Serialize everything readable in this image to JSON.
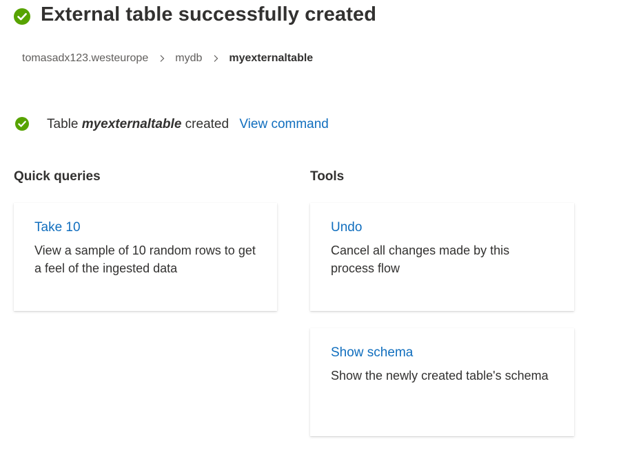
{
  "header": {
    "title": "External table successfully created",
    "status_color": "#57a300"
  },
  "breadcrumb": {
    "items": [
      "tomasadx123.westeurope",
      "mydb",
      "myexternaltable"
    ]
  },
  "status": {
    "prefix": "Table",
    "table_name": "myexternaltable",
    "suffix": "created",
    "view_command": "View command"
  },
  "quick_queries": {
    "heading": "Quick queries",
    "cards": [
      {
        "title": "Take 10",
        "description": "View a sample of 10 random rows to get a feel of the ingested data"
      }
    ]
  },
  "tools": {
    "heading": "Tools",
    "cards": [
      {
        "title": "Undo",
        "description": "Cancel all changes made by this process flow"
      },
      {
        "title": "Show schema",
        "description": "Show the newly created table's schema"
      }
    ]
  },
  "colors": {
    "link": "#106ebe",
    "text": "#323130",
    "success": "#57a300"
  }
}
